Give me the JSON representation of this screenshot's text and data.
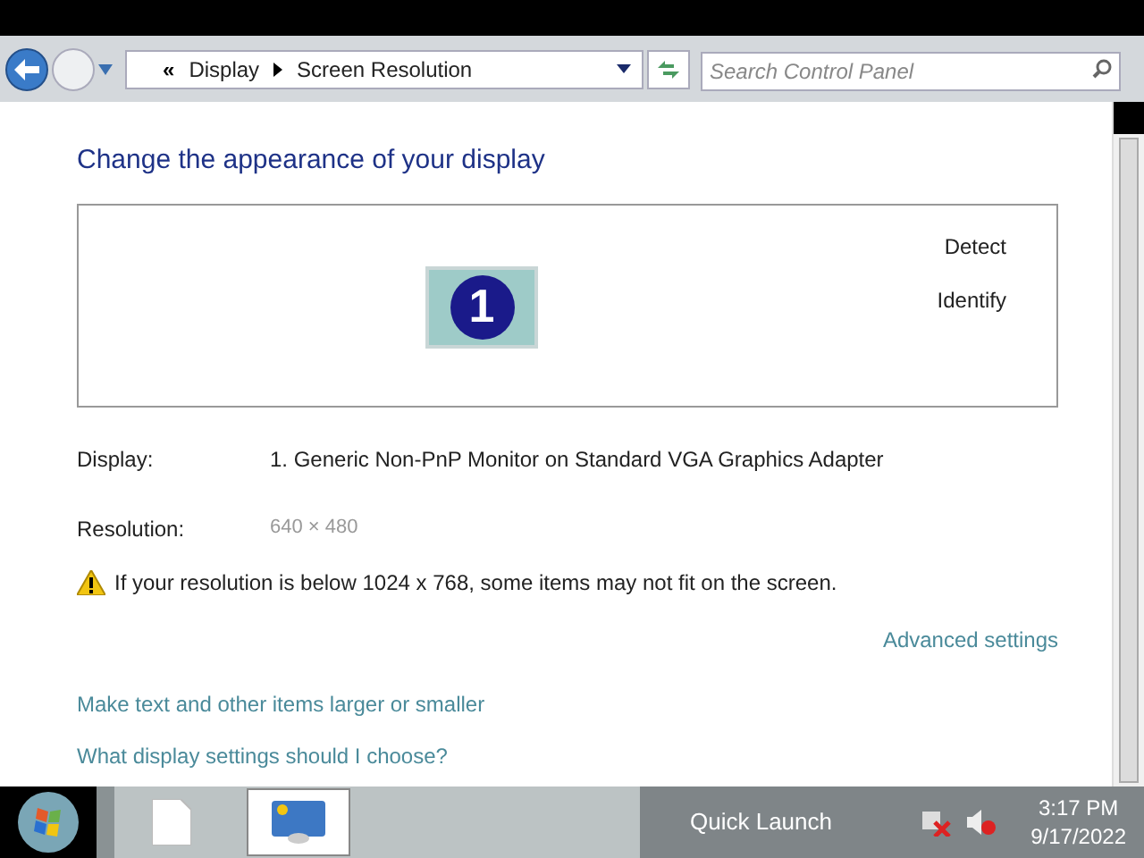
{
  "address_bar": {
    "overflow": "«",
    "crumbs": [
      "Display",
      "Screen Resolution"
    ]
  },
  "search": {
    "placeholder": "Search Control Panel"
  },
  "heading": "Change the appearance of your display",
  "monitor_preview": {
    "monitor_label": "1",
    "buttons": [
      "Detect",
      "Identify"
    ]
  },
  "display": {
    "label": "Display:",
    "value": "1. Generic Non-PnP Monitor on Standard VGA Graphics Adapter"
  },
  "resolution": {
    "label": "Resolution:",
    "value": "640 × 480",
    "disabled": true
  },
  "warning": "If your resolution is below 1024 x 768, some items may not fit on the screen.",
  "advanced_link": "Advanced settings",
  "links": [
    "Make text and other items larger or smaller",
    "What display settings should I choose?"
  ],
  "taskbar": {
    "items": [
      {
        "kind": "document",
        "selected": false
      },
      {
        "kind": "display",
        "selected": true
      }
    ],
    "quick_launch": "Quick Launch",
    "time": "3:17 PM",
    "date": "9/17/2022"
  }
}
